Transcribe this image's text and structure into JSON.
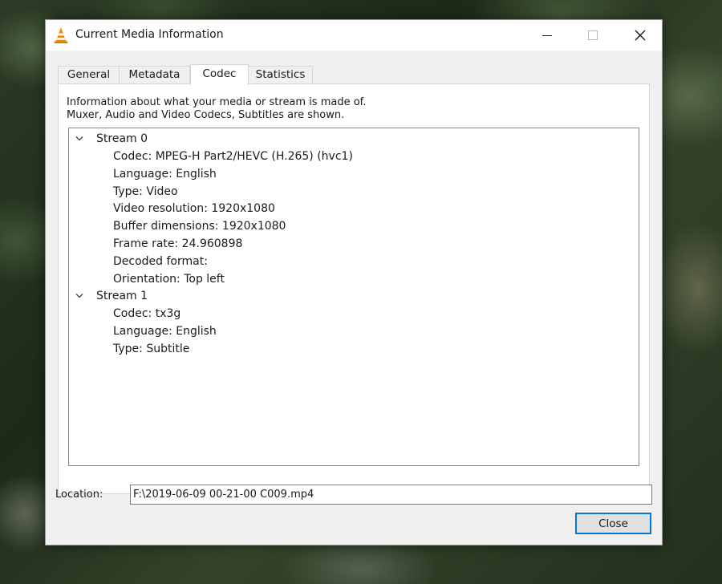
{
  "window": {
    "title": "Current Media Information",
    "icon": "vlc-cone-icon",
    "controls": [
      "minimize-icon",
      "maximize-icon",
      "close-icon"
    ]
  },
  "tabs": [
    {
      "label": "General",
      "active": false
    },
    {
      "label": "Metadata",
      "active": false
    },
    {
      "label": "Codec",
      "active": true
    },
    {
      "label": "Statistics",
      "active": false
    }
  ],
  "codec": {
    "info_line1": "Information about what your media or stream is made of.",
    "info_line2": "Muxer, Audio and Video Codecs, Subtitles are shown.",
    "streams": [
      {
        "label": "Stream 0",
        "expanded": true,
        "props": [
          "Codec: MPEG-H Part2/HEVC (H.265) (hvc1)",
          "Language: English",
          "Type: Video",
          "Video resolution: 1920x1080",
          "Buffer dimensions: 1920x1080",
          "Frame rate: 24.960898",
          "Decoded format:",
          "Orientation: Top left"
        ]
      },
      {
        "label": "Stream 1",
        "expanded": true,
        "props": [
          "Codec: tx3g",
          "Language: English",
          "Type: Subtitle"
        ]
      }
    ]
  },
  "location": {
    "label": "Location:",
    "value": "F:\\2019-06-09 00-21-00 C009.mp4"
  },
  "buttons": {
    "close": "Close"
  },
  "colors": {
    "accent": "#0078d7",
    "vlc_orange": "#f08a00"
  }
}
